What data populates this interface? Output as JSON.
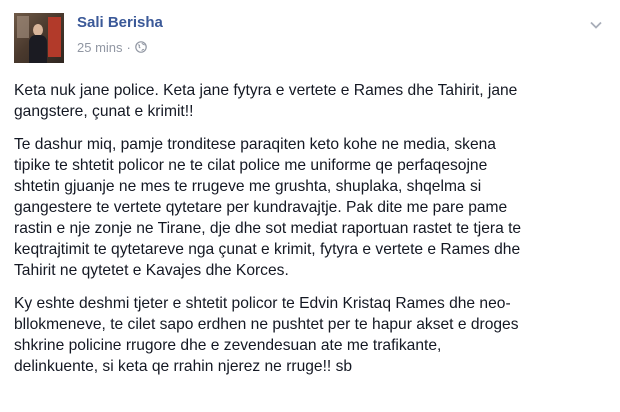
{
  "post": {
    "author": "Sali Berisha",
    "timestamp": "25 mins",
    "separator": "·",
    "privacy_icon": "globe-icon",
    "menu_icon": "chevron-down-icon",
    "paragraphs": [
      "Keta nuk jane police. Keta jane fytyra e vertete e Rames dhe Tahirit, jane\ngangstere, çunat e krimit!!",
      "Te dashur miq, pamje tronditese paraqiten keto kohe ne media, skena\ntipike te shtetit policor ne te cilat police me uniforme qe perfaqesojne\nshtetin gjuanje ne mes te rrugeve me grushta, shuplaka, shqelma si\ngangestere te vertete qytetare per kundravajtje. Pak dite me pare pame\nrastin e nje zonje ne Tirane, dje dhe sot mediat raportuan rastet te tjera te\nkeqtrajtimit te qytetareve nga çunat e krimit, fytyra e vertete e Rames dhe\nTahirit ne qytetet e Kavajes dhe Korces.",
      "Ky eshte deshmi tjeter e shtetit policor te Edvin Kristaq Rames dhe neo-\nbllokmeneve, te cilet sapo erdhen ne pushtet per te hapur akset e droges\nshkrine policine rrugore dhe e zevendesuan ate me trafikante,\ndelinkuente, si keta qe rrahin njerez ne rruge!! sb"
    ]
  },
  "colors": {
    "author": "#3b5998",
    "meta": "#9197a3",
    "text": "#141823"
  }
}
